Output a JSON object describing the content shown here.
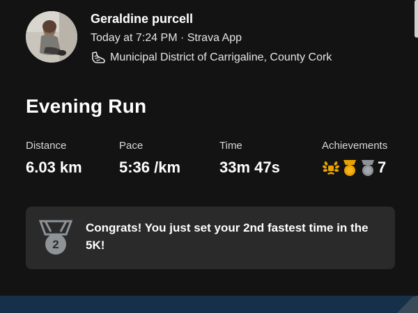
{
  "athlete": {
    "name": "Geraldine purcell",
    "time_line": "Today at 7:24 PM · Strava App",
    "location": "Municipal District of Carrigaline, County Cork"
  },
  "activity": {
    "title": "Evening Run"
  },
  "stats": {
    "distance_label": "Distance",
    "distance_value": "6.03 km",
    "pace_label": "Pace",
    "pace_value": "5:36 /km",
    "time_label": "Time",
    "time_value": "33m 47s",
    "achievements_label": "Achievements",
    "achievements_count": "7",
    "achievement_icons": [
      "laurel-icon",
      "gold-medal-icon",
      "silver-medal-icon"
    ]
  },
  "congrats": {
    "text": "Congrats! You just set your 2nd fastest time in the 5K!",
    "medal_number": "2",
    "icon": "silver-medal-icon"
  },
  "colors": {
    "background": "#131313",
    "card": "#2a2a2a",
    "gold": "#e8a100",
    "silver": "#8e9398",
    "bottom_strip": "#153048"
  }
}
